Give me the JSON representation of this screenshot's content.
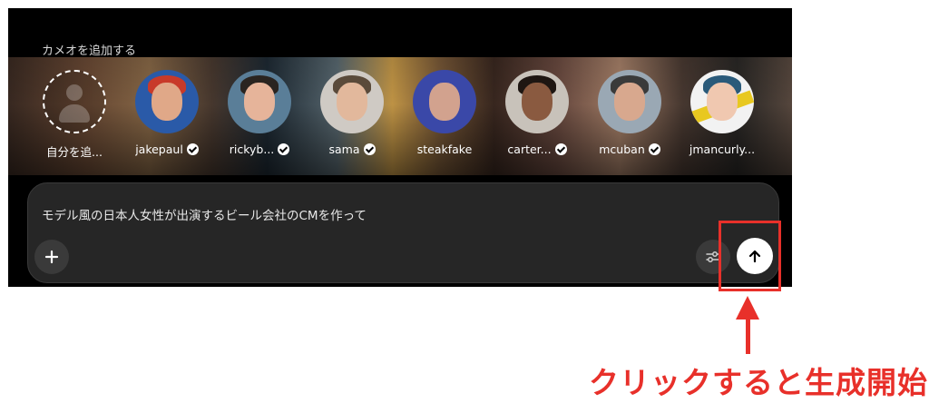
{
  "cameo_section": {
    "title": "カメオを追加する",
    "items": [
      {
        "label": "自分を追...",
        "verified": false,
        "type": "add-self"
      },
      {
        "label": "jakepaul",
        "verified": true
      },
      {
        "label": "rickyb...",
        "verified": true
      },
      {
        "label": "sama",
        "verified": true
      },
      {
        "label": "steakfake",
        "verified": false
      },
      {
        "label": "carter...",
        "verified": true
      },
      {
        "label": "mcuban",
        "verified": true
      },
      {
        "label": "jmancurly...",
        "verified": false
      }
    ]
  },
  "composer": {
    "prompt_text": "モデル風の日本人女性が出演するビール会社のCMを作って",
    "add_icon": "plus-icon",
    "settings_icon": "sliders-icon",
    "send_icon": "arrow-up-icon"
  },
  "annotation": {
    "caption": "クリックすると生成開始",
    "color": "#e8302a"
  }
}
